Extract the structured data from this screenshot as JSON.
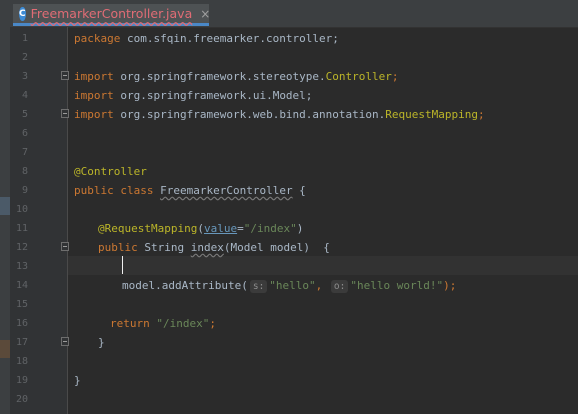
{
  "tab": {
    "icon_letter": "C",
    "filename": "FreemarkerController.java",
    "close_glyph": "×"
  },
  "line_numbers": [
    "1",
    "2",
    "3",
    "4",
    "5",
    "6",
    "7",
    "8",
    "9",
    "10",
    "11",
    "12",
    "13",
    "14",
    "15",
    "16",
    "17",
    "18",
    "19",
    "20"
  ],
  "code": {
    "l1": {
      "kw": "package",
      "rest": " com.sfqin.freemarker.controller;"
    },
    "l3": {
      "kw": "import",
      "pkg": " org.springframework.stereotype.",
      "cls": "Controller",
      "end": ";"
    },
    "l4": {
      "kw": "import",
      "pkg": " org.springframework.ui.Model;"
    },
    "l5": {
      "kw": "import",
      "pkg": " org.springframework.web.bind.annotation.",
      "cls": "RequestMapping",
      "end": ";"
    },
    "l8": {
      "ann": "@Controller"
    },
    "l9": {
      "kw1": "public",
      "kw2": " class ",
      "name": "FreemarkerController",
      "end": " {"
    },
    "l11": {
      "ann": "@RequestMapping",
      "p1": "(",
      "attr": "value",
      "eq": "=",
      "str": "\"/index\"",
      "p2": ")"
    },
    "l12": {
      "kw": "public",
      "type": " String ",
      "name": "index",
      "params": "(Model model)  {"
    },
    "l14": {
      "call": "model.addAttribute(",
      "hint1": "s:",
      "str1": "\"hello\"",
      "comma": ", ",
      "hint2": "o:",
      "str2": "\"hello world!\"",
      "end": ");"
    },
    "l16": {
      "kw": "return",
      "sp": " ",
      "str": "\"/index\"",
      "end": ";"
    },
    "l17": {
      "brace": "}"
    },
    "l19": {
      "brace": "}"
    }
  },
  "colors": {
    "background": "#2b2b2b",
    "keyword": "#cc7832",
    "annotation": "#bbb529",
    "string": "#6a8759",
    "tab_label": "#e06c75"
  }
}
